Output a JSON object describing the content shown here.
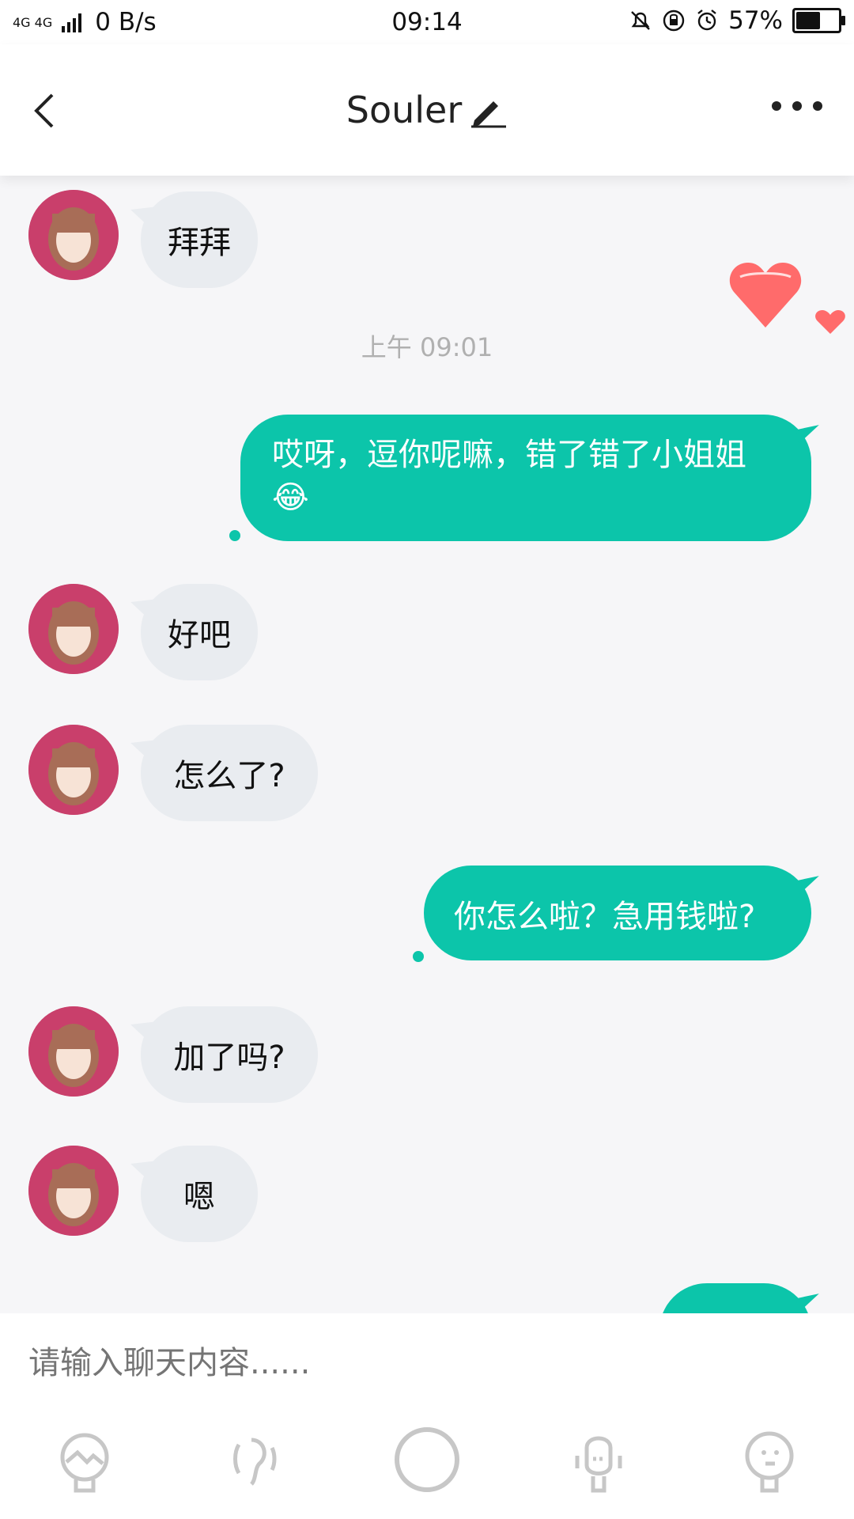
{
  "status_bar": {
    "network": "4G 4G",
    "speed": "0 B/s",
    "time": "09:14",
    "battery": "57%"
  },
  "header": {
    "title": "Souler"
  },
  "messages": [
    {
      "side": "in",
      "text": "拜拜"
    },
    {
      "type": "timestamp",
      "text": "上午 09:01"
    },
    {
      "side": "out",
      "text": "哎呀，逗你呢嘛，错了错了小姐姐",
      "emoji": "😂"
    },
    {
      "side": "in",
      "text": "好吧"
    },
    {
      "side": "in",
      "text": "怎么了?"
    },
    {
      "side": "out",
      "text": "你怎么啦？急用钱啦?"
    },
    {
      "side": "in",
      "text": "加了吗?"
    },
    {
      "side": "in",
      "text": "嗯"
    }
  ],
  "input": {
    "placeholder": "请输入聊天内容......"
  },
  "toolbar": {
    "icons": [
      "image-icon",
      "voice-icon",
      "record-icon",
      "mic-icon",
      "emoji-icon"
    ]
  },
  "colors": {
    "accent": "#0cc5aa",
    "incoming_bubble": "#e9ecf0",
    "avatar_bg": "#c93f6b",
    "heart": "#ff6b6b"
  }
}
